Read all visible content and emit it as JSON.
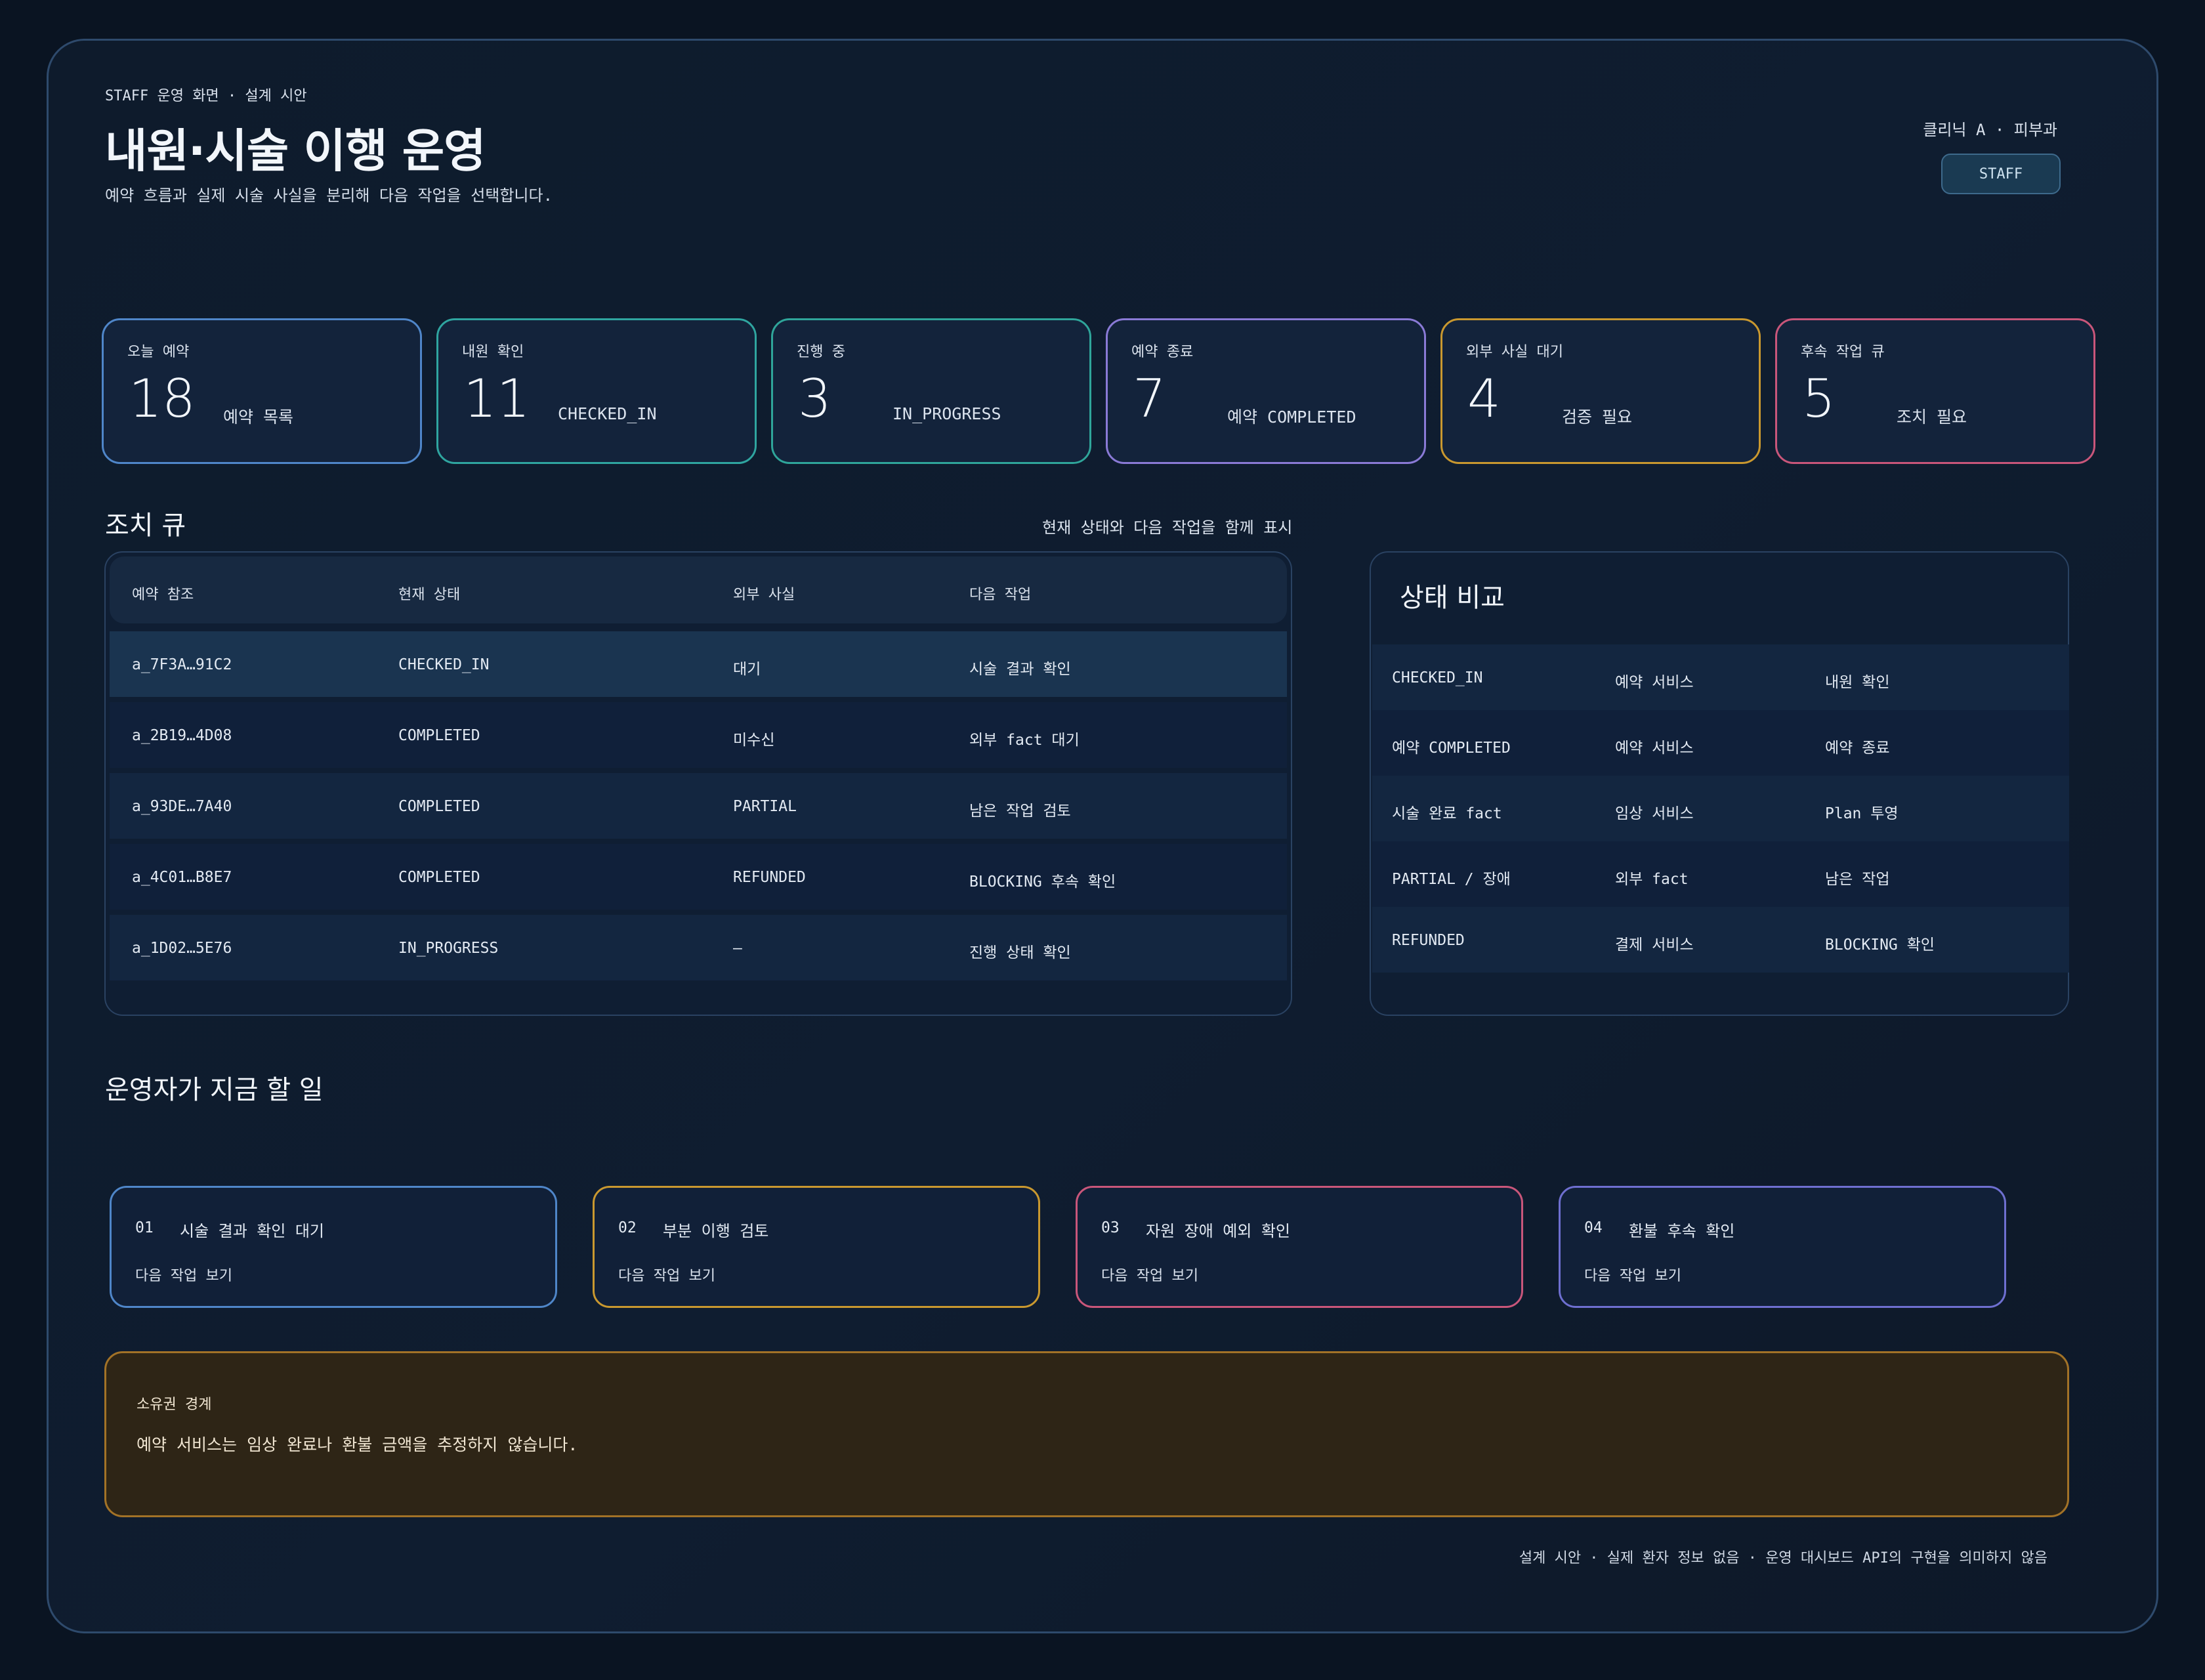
{
  "header": {
    "eyebrow": "STAFF 운영 화면 · 설계 시안",
    "title": "내원·시술 이행 운영",
    "subtitle": "예약 흐름과 실제 시술 사실을 분리해 다음 작업을 선택합니다.",
    "clinic": "클리닉 A · 피부과",
    "role_button": "STAFF"
  },
  "kpis": [
    {
      "label": "오늘 예약",
      "value": "18",
      "note": "예약 목록",
      "color": "#4f86c9"
    },
    {
      "label": "내원 확인",
      "value": "11",
      "note": "CHECKED_IN",
      "color": "#2fa5a0"
    },
    {
      "label": "진행 중",
      "value": "3",
      "note": "IN_PROGRESS",
      "color": "#2fa59a"
    },
    {
      "label": "예약 종료",
      "value": "7",
      "note": "예약 COMPLETED",
      "color": "#8a7ad6"
    },
    {
      "label": "외부 사실 대기",
      "value": "4",
      "note": "검증 필요",
      "color": "#c9982f"
    },
    {
      "label": "후속 작업 큐",
      "value": "5",
      "note": "조치 필요",
      "color": "#c9567a"
    }
  ],
  "queue": {
    "title": "조치 큐",
    "caption": "현재 상태와 다음 작업을 함께 표시",
    "columns": [
      "예약 참조",
      "현재 상태",
      "외부 사실",
      "다음 작업"
    ],
    "rows": [
      {
        "ref": "a_7F3A…91C2",
        "state": "CHECKED_IN",
        "fact": "대기",
        "next": "시술 결과 확인",
        "highlight": true
      },
      {
        "ref": "a_2B19…4D08",
        "state": "COMPLETED",
        "fact": "미수신",
        "next": "외부 fact 대기"
      },
      {
        "ref": "a_93DE…7A40",
        "state": "COMPLETED",
        "fact": "PARTIAL",
        "next": "남은 작업 검토"
      },
      {
        "ref": "a_4C01…B8E7",
        "state": "COMPLETED",
        "fact": "REFUNDED",
        "next": "BLOCKING 후속 확인"
      },
      {
        "ref": "a_1D02…5E76",
        "state": "IN_PROGRESS",
        "fact": "—",
        "next": "진행 상태 확인"
      }
    ]
  },
  "comparison": {
    "title": "상태 비교",
    "rows": [
      [
        "CHECKED_IN",
        "예약 서비스",
        "내원 확인"
      ],
      [
        "예약 COMPLETED",
        "예약 서비스",
        "예약 종료"
      ],
      [
        "시술 완료 fact",
        "임상 서비스",
        "Plan 투영"
      ],
      [
        "PARTIAL / 장애",
        "외부 fact",
        "남은 작업"
      ],
      [
        "REFUNDED",
        "결제 서비스",
        "BLOCKING 확인"
      ]
    ]
  },
  "todo": {
    "title": "운영자가 지금 할 일",
    "tasks": [
      {
        "num": "01",
        "label": "시술 결과 확인 대기",
        "link": "다음 작업 보기",
        "color": "#4f86c9"
      },
      {
        "num": "02",
        "label": "부분 이행 검토",
        "link": "다음 작업 보기",
        "color": "#c9982f"
      },
      {
        "num": "03",
        "label": "자원 장애 예외 확인",
        "link": "다음 작업 보기",
        "color": "#c9567a"
      },
      {
        "num": "04",
        "label": "환불 후속 확인",
        "link": "다음 작업 보기",
        "color": "#6e6fd0"
      }
    ]
  },
  "ownership": {
    "title": "소유권 경계",
    "text": "예약 서비스는 임상 완료나 환불 금액을 추정하지 않습니다."
  },
  "footer": "설계 시안 · 실제 환자 정보 없음 · 운영 대시보드 API의 구현을 의미하지 않음"
}
